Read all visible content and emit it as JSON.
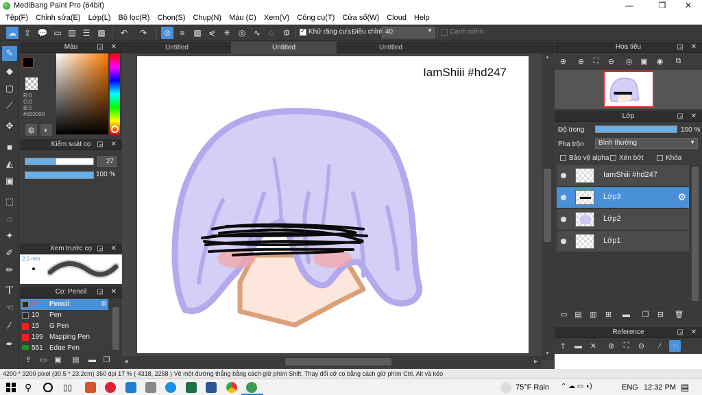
{
  "window": {
    "title": "MediBang Paint Pro (64bit)",
    "min": "—",
    "max": "❐",
    "close": "✕"
  },
  "menu": [
    "Tệp(F)",
    "Chỉnh sửa(E)",
    "Lớp(L)",
    "Bộ lọc(R)",
    "Chọn(S)",
    "Chụp(N)",
    "Màu (C)",
    "Xem(V)",
    "Công cụ(T)",
    "Cửa sổ(W)",
    "Cloud",
    "Help"
  ],
  "toolbar": {
    "antialias_label": "Khử răng cưa",
    "antialias_checked": true,
    "correction_label": "Điều chỉnh",
    "correction_value": "40",
    "snap_label": "Cạnh mềm",
    "snap_checked": false
  },
  "color_panel": {
    "title": "Màu",
    "rgb_r": "R:0",
    "rgb_g": "G:0",
    "rgb_b": "B:0",
    "hex": "#000000"
  },
  "brush_control": {
    "title": "Kiểm soát cọ",
    "size": "27",
    "opacity": "100 %",
    "size_fraction": 0.45,
    "opacity_fraction": 1.0
  },
  "brush_preview": {
    "title": "Xem trước cọ",
    "size_label": "2.0 mm"
  },
  "brush_list": {
    "title": "Cọ: Pencil",
    "items": [
      {
        "size": "27",
        "name": "Pencil",
        "color": "#2a2a2a",
        "active": true
      },
      {
        "size": "10",
        "name": "Pen",
        "color": "#2a2a2a",
        "active": false
      },
      {
        "size": "15",
        "name": "G Pen",
        "color": "#e22",
        "active": false
      },
      {
        "size": "199",
        "name": "Mapping Pen",
        "color": "#e22",
        "active": false
      },
      {
        "size": "551",
        "name": "Edge Pen",
        "color": "#2a8a2a",
        "active": false
      }
    ]
  },
  "documents": {
    "tabs": [
      "Untitled",
      "Untitled",
      "Untitled"
    ],
    "active_index": 1
  },
  "canvas": {
    "watermark": "IamShiii #hd247"
  },
  "navigator": {
    "title": "Hoa tiêu"
  },
  "layers": {
    "title": "Lớp",
    "opacity_label": "Độ trong",
    "opacity_value": "100 %",
    "opacity_fraction": 1.0,
    "blend_label": "Pha trộn",
    "blend_value": "Bình thường",
    "protect_alpha": "Bảo vệ alpha",
    "clipping": "Xén bớt",
    "lock": "Khóa",
    "items": [
      {
        "name": "IamShiii #hd247",
        "active": false
      },
      {
        "name": "Lớp3",
        "active": true
      },
      {
        "name": "Lớp2",
        "active": false
      },
      {
        "name": "Lớp1",
        "active": false
      }
    ]
  },
  "reference": {
    "title": "Reference"
  },
  "status": {
    "text": "4200 * 3200 pixel  (30.5 * 23.2cm)  350 dpi  17 %  ( 4318, 2258 )  Vẽ một đường thẳng bằng cách giữ phím Shift, Thay đổi cỡ cọ bằng cách giữ phím Ctrl, Alt và kéo"
  },
  "taskbar": {
    "weather": "75°F Rain",
    "language": "ENG",
    "time": "12:32 PM"
  },
  "colors": {
    "accent": "#4a90d9",
    "hair": "#cfcaf5",
    "hair_outline": "#b3a9ec",
    "skin": "#fde6dc",
    "skin_outline": "#d9a07a",
    "blush": "#f7a4a4"
  }
}
